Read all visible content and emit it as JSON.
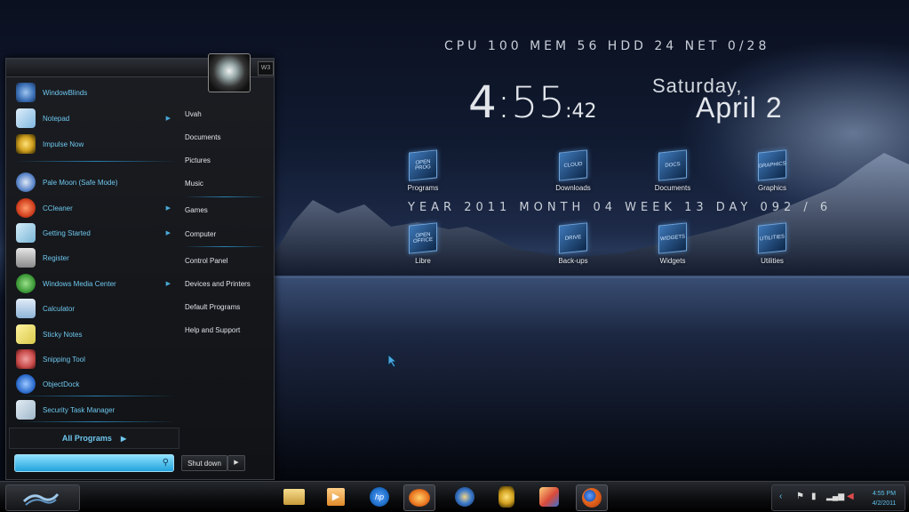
{
  "desktop": {
    "stats": "CPU 100 MEM 56 HDD 24 NET 0/28",
    "clock": {
      "hour": "4",
      "minutes": ":55",
      "seconds": ":42"
    },
    "date": {
      "weekday": "Saturday,",
      "date": "April 2"
    },
    "calendar_line": "YEAR 2011 MONTH 04 WEEK 13 DAY 092 / 6",
    "icons": [
      {
        "label": "Programs",
        "tile": "OPEN PROG"
      },
      {
        "label": "Downloads",
        "tile": "CLOUD"
      },
      {
        "label": "Documents",
        "tile": "DOCS"
      },
      {
        "label": "Graphics",
        "tile": "GRAPHICS"
      },
      {
        "label": "Libre",
        "tile": "OPEN OFFICE"
      },
      {
        "label": "Back-ups",
        "tile": "DRIVE"
      },
      {
        "label": "Widgets",
        "tile": "WIDGETS"
      },
      {
        "label": "Utilities",
        "tile": "UTILITIES"
      }
    ]
  },
  "start_menu": {
    "badge": "W3",
    "programs": [
      {
        "label": "WindowBlinds",
        "icon": "windowblinds-icon",
        "color": "#3a6fb5",
        "has_submenu": false
      },
      {
        "label": "Notepad",
        "icon": "notepad-icon",
        "color": "#7fb6e0",
        "has_submenu": true
      },
      {
        "label": "Impulse Now",
        "icon": "impulse-icon",
        "color": "#d1a01f",
        "has_submenu": false
      },
      {
        "label": "Pale Moon (Safe Mode)",
        "icon": "pale-moon-icon",
        "color": "#5b86c9",
        "has_submenu": false
      },
      {
        "label": "CCleaner",
        "icon": "ccleaner-icon",
        "color": "#d2401f",
        "has_submenu": true
      },
      {
        "label": "Getting Started",
        "icon": "getting-started-icon",
        "color": "#7ab5d6",
        "has_submenu": true
      },
      {
        "label": "Register",
        "icon": "register-icon",
        "color": "#c9c9c9",
        "has_submenu": false
      },
      {
        "label": "Windows Media Center",
        "icon": "media-center-icon",
        "color": "#3f9c3a",
        "has_submenu": true
      },
      {
        "label": "Calculator",
        "icon": "calculator-icon",
        "color": "#8fb4d8",
        "has_submenu": false
      },
      {
        "label": "Sticky Notes",
        "icon": "sticky-notes-icon",
        "color": "#d8c94a",
        "has_submenu": false
      },
      {
        "label": "Snipping Tool",
        "icon": "snipping-tool-icon",
        "color": "#c84a4a",
        "has_submenu": false
      },
      {
        "label": "ObjectDock",
        "icon": "objectdock-icon",
        "color": "#2f6fd0",
        "has_submenu": false
      },
      {
        "label": "Security Task Manager",
        "icon": "security-task-manager-icon",
        "color": "#9fb6c8",
        "has_submenu": false
      }
    ],
    "all_programs": "All Programs",
    "right_items": [
      "Uvah",
      "Documents",
      "Pictures",
      "Music",
      "Games",
      "Computer",
      "Control Panel",
      "Devices and Printers",
      "Default Programs",
      "Help and Support"
    ],
    "shutdown": "Shut down"
  },
  "taskbar": {
    "pinned": [
      {
        "name": "file-explorer-icon",
        "color": "#d8b45a"
      },
      {
        "name": "media-player-icon",
        "color": "#e08a2a"
      },
      {
        "name": "hp-icon",
        "color": "#1f6fc9"
      },
      {
        "name": "xchat-icon",
        "color": "#e8731f"
      },
      {
        "name": "pale-moon-icon",
        "color": "#3a78c9"
      },
      {
        "name": "impulse-icon",
        "color": "#d1a01f"
      },
      {
        "name": "paint-icon",
        "color": "#d84a3a"
      },
      {
        "name": "firefox-icon",
        "color": "#e86a1f"
      }
    ],
    "tray": {
      "time": "4:55 PM",
      "date": "4/2/2011"
    }
  }
}
